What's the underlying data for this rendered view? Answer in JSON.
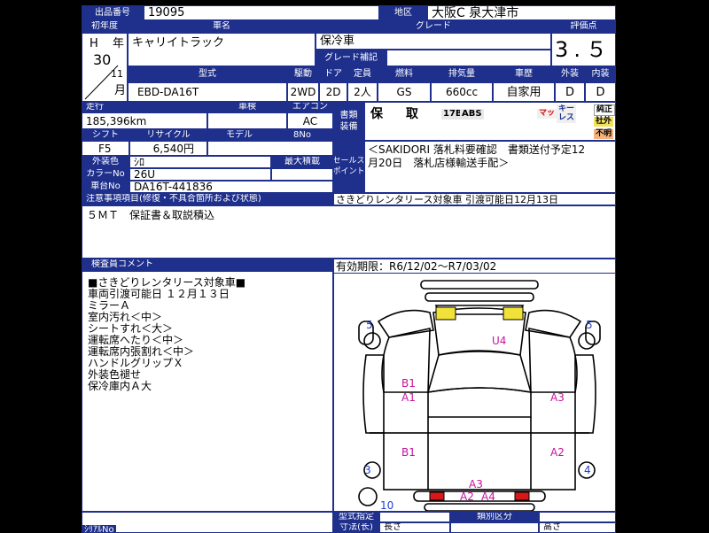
{
  "header": {
    "lot_label": "出品番号",
    "lot_value": "19095",
    "area_label": "地区",
    "area_value": "大阪C 泉大津市"
  },
  "vehicle": {
    "year_label": "初年度",
    "era": "H",
    "year_unit": "年",
    "year": "30",
    "month": "11",
    "month_unit": "月",
    "name_label": "車名",
    "name": "キャリイトラック",
    "grade_label": "グレード",
    "grade": "保冷車",
    "grade_note_label": "グレード補記",
    "grade_note": "",
    "rating_label": "評価点",
    "rating": "3.５"
  },
  "specs": {
    "model_code_label": "型式",
    "model_code": "EBD-DA16T",
    "drive_label": "駆動",
    "drive": "2WD",
    "doors_label": "ドア",
    "doors": "2D",
    "capacity_label": "定員",
    "capacity": "2人",
    "fuel_label": "燃料",
    "fuel": "GS",
    "displacement_label": "排気量",
    "displacement": "660cc",
    "history_label": "車歴",
    "history": "自家用",
    "exterior_label": "外装",
    "exterior": "D",
    "interior_label": "内装",
    "interior": "D"
  },
  "details": {
    "mileage_label": "走行",
    "mileage": "185,396km",
    "inspection_label": "車検",
    "inspection": "",
    "aircon_label": "エアコン",
    "aircon": "AC",
    "shift_label": "シフト",
    "shift": "F5",
    "recycle_label": "リサイクル",
    "recycle": "6,540円",
    "model_year_label": "モデル",
    "model_year": "8No",
    "color_label": "外装色",
    "color": "ｼﾛ",
    "max_load_label": "最大積載",
    "max_load": "",
    "color_no_label": "カラーNo",
    "color_no": "26U",
    "chassis_label": "車台No",
    "chassis": "DA16T-441836"
  },
  "documents": {
    "label_line1": "書類",
    "label_line2": "装備",
    "status1": "保",
    "status2": "取",
    "equipment": [
      "17B",
      "ABS"
    ],
    "badges": [
      {
        "text": "マット",
        "bg": "#f0f0f0",
        "fg": "#d01010"
      },
      {
        "text": "キー",
        "bg": "#f0f0f0",
        "fg": "#1e2f8c"
      },
      {
        "text": "レス",
        "bg": "#f0f0f0",
        "fg": "#1e2f8c"
      },
      {
        "text": "純正",
        "bg": "#ffffff",
        "fg": "#000000"
      },
      {
        "text": "社外",
        "bg": "#f3e15a",
        "fg": "#000000"
      },
      {
        "text": "不明",
        "bg": "#f5b27a",
        "fg": "#000000"
      }
    ]
  },
  "sales_point": {
    "label_line1": "セールス",
    "label_line2": "ポイント",
    "line1": "＜SAKIDORI 落札料要確認　書類送付予定12",
    "line2": "月20日　落札店様輸送手配＞"
  },
  "notes": {
    "label": "注意事項項目(修復・不具合箇所および状態)",
    "value": "さきどりレンタリース対象車 引渡可能日12月13日",
    "body": "５ＭＴ　保証書＆取説積込"
  },
  "inspector": {
    "label": "検査員コメント",
    "lines": [
      "■さきどりレンタリース対象車■",
      "車両引渡可能日 １２月１３日",
      "ミラーＡ",
      "室内汚れ＜中＞",
      "シートすれ＜大＞",
      "運転席へたり＜中＞",
      "運転席内張割れ＜中＞",
      "ハンドルグリップＸ",
      "外装色褪せ",
      "保冷庫内Ａ大"
    ]
  },
  "validity": {
    "label": "有効期限：",
    "value": "R6/12/02～R7/03/02"
  },
  "diagram": {
    "labels": [
      {
        "text": "5",
        "color": "blue"
      },
      {
        "text": "5",
        "color": "blue"
      },
      {
        "text": "U4",
        "color": "pink"
      },
      {
        "text": "B1",
        "color": "pink"
      },
      {
        "text": "A1",
        "color": "pink"
      },
      {
        "text": "A3",
        "color": "pink"
      },
      {
        "text": "B1",
        "color": "pink"
      },
      {
        "text": "A2",
        "color": "pink"
      },
      {
        "text": "3",
        "color": "blue"
      },
      {
        "text": "4",
        "color": "blue"
      },
      {
        "text": "10",
        "color": "blue"
      },
      {
        "text": "A3",
        "color": "pink"
      },
      {
        "text": "A2",
        "color": "pink"
      },
      {
        "text": "A4",
        "color": "pink"
      }
    ],
    "colors": {
      "yellow": "#f1e23a",
      "red": "#d81818",
      "blue": "#1e3fd0",
      "pink": "#c8139b"
    }
  },
  "bottom": {
    "type_spec_label": "型式指定",
    "class_label": "類別区分",
    "dims_label": "寸法(长)",
    "length_label": "長さ",
    "height_label": "高さ",
    "extra_label": "ｼﾘｱﾙNo"
  }
}
